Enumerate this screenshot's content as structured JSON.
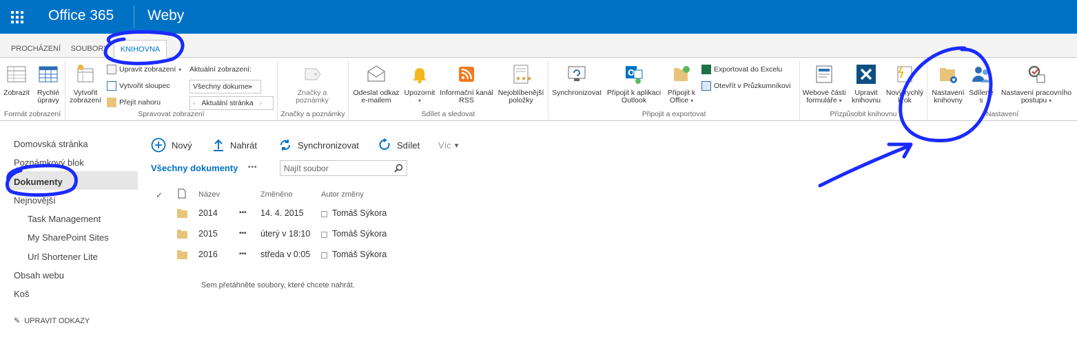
{
  "topbar": {
    "brand": "Office 365",
    "site": "Weby"
  },
  "tabs": [
    {
      "label": "PROCHÁZENÍ"
    },
    {
      "label": "SOUBORY"
    },
    {
      "label": "KNIHOVNA",
      "active": true
    }
  ],
  "ribbon": {
    "groups": {
      "format": "Formát zobrazení",
      "manage": "Spravovat zobrazení",
      "tags": "Značky a poznámky",
      "share": "Sdílet a sledovat",
      "connect": "Připojit a exportovat",
      "customize": "Přizpůsobit knihovnu",
      "settings": "Nastavení"
    },
    "buttons": {
      "zobrazit": "Zobrazit",
      "rychle_1": "Rychlé",
      "rychle_2": "úpravy",
      "vytvorit_1": "Vytvořit",
      "vytvorit_2": "zobrazení",
      "upravit_zobrazeni": "Upravit zobrazení",
      "vytvorit_sloupec": "Vytvořit sloupec",
      "prejit_nahoru": "Přejít nahoru",
      "aktualni_zobrazeni": "Aktuální zobrazení:",
      "view_select": "Všechny dokumenty",
      "aktualni_stranka": "Aktuální stránka",
      "znacky_1": "Značky a",
      "znacky_2": "poznámky",
      "odeslat_1": "Odeslat odkaz",
      "odeslat_2": "e-mailem",
      "upozornit": "Upozornit",
      "rss_1": "Informační kanál",
      "rss_2": "RSS",
      "oblibene_1": "Nejoblíbenější",
      "oblibene_2": "položky",
      "synchronizovat": "Synchronizovat",
      "outlook_1": "Připojit k aplikaci",
      "outlook_2": "Outlook",
      "office_1": "Připojit k",
      "office_2": "Office",
      "excel": "Exportovat do Excelu",
      "explorer": "Otevřít v Průzkumníkovi",
      "webparts_1": "Webové části",
      "webparts_2": "formuláře",
      "upravit_knihovnu_1": "Upravit",
      "upravit_knihovnu_2": "knihovnu",
      "novy_rychly_1": "Nový rychlý",
      "novy_rychly_2": "krok",
      "nastaveni_knihovny_1": "Nastavení",
      "nastaveni_knihovny_2": "knihovny",
      "sdilene_1": "Sdílené",
      "sdilene_2": "s",
      "pracovni_1": "Nastavení pracovního",
      "pracovni_2": "postupu"
    }
  },
  "nav": {
    "items": [
      {
        "label": "Domovská stránka"
      },
      {
        "label": "Poznámkový blok"
      },
      {
        "label": "Dokumenty"
      },
      {
        "label": "Nejnovější"
      },
      {
        "label": "Task Management"
      },
      {
        "label": "My SharePoint Sites"
      },
      {
        "label": "Url Shortener Lite"
      },
      {
        "label": "Obsah webu"
      },
      {
        "label": "Koš"
      }
    ],
    "edit_links": "UPRAVIT ODKAZY"
  },
  "commands": {
    "new": "Nový",
    "upload": "Nahrát",
    "sync": "Synchronizovat",
    "share": "Sdílet",
    "more": "Víc"
  },
  "view": {
    "name": "Všechny dokumenty",
    "more": "•••",
    "search_placeholder": "Najít soubor"
  },
  "table": {
    "headers": {
      "check": "✓",
      "name": "Název",
      "modified": "Změněno",
      "author": "Autor změny"
    },
    "rows": [
      {
        "name": "2014",
        "dots": "•••",
        "modified": "14. 4. 2015",
        "author": "Tomáš Sýkora"
      },
      {
        "name": "2015",
        "dots": "•••",
        "modified": "úterý v 18:10",
        "author": "Tomáš Sýkora"
      },
      {
        "name": "2016",
        "dots": "•••",
        "modified": "středa v 0:05",
        "author": "Tomáš Sýkora"
      }
    ]
  },
  "drop_hint": "Sem přetáhněte soubory, které chcete nahrát.",
  "colors": {
    "suite_bar": "#0072c6",
    "link": "#0072c6",
    "annotation": "#1a2bff",
    "folder": "#e8c37a"
  }
}
